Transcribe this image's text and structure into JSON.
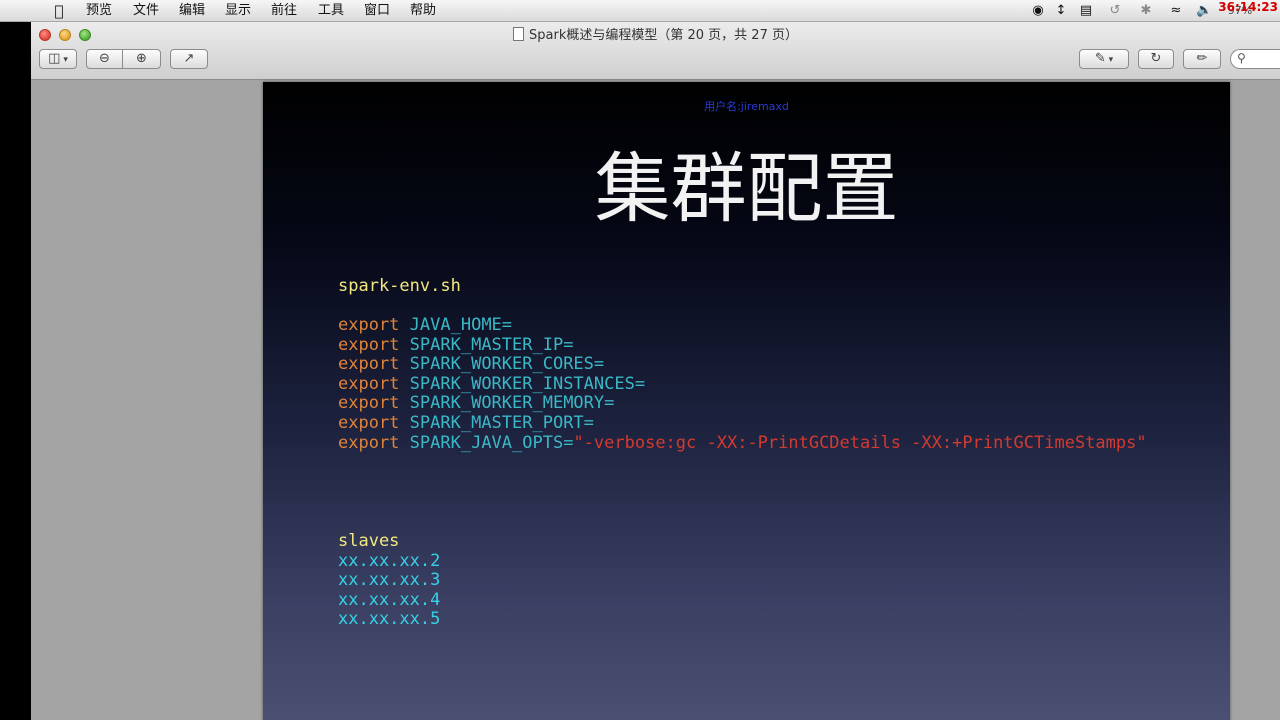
{
  "menubar": {
    "items": [
      "预览",
      "文件",
      "编辑",
      "显示",
      "前往",
      "工具",
      "窗口",
      "帮助"
    ],
    "clock": "36:14:23",
    "battery": "97%"
  },
  "window": {
    "title": "Spark概述与编程模型（第 20 页，共 27 页）"
  },
  "toolbar": {
    "sidebar_icon": "sidebar-icon",
    "zoom_out_icon": "zoom-out-icon",
    "zoom_in_icon": "zoom-in-icon",
    "share_icon": "share-icon",
    "annotate_icon": "pen-icon",
    "rotate_icon": "rotate-icon",
    "edit_icon": "edit-icon",
    "search_icon": "search-icon"
  },
  "slide": {
    "watermark": "用户名:jiremaxd",
    "title": "集群配置",
    "env_file": "spark-env.sh",
    "exports": [
      {
        "keyword": "export",
        "name": "JAVA_HOME=",
        "value": ""
      },
      {
        "keyword": "export",
        "name": "SPARK_MASTER_IP=",
        "value": ""
      },
      {
        "keyword": "export",
        "name": "SPARK_WORKER_CORES=",
        "value": ""
      },
      {
        "keyword": "export",
        "name": "SPARK_WORKER_INSTANCES=",
        "value": ""
      },
      {
        "keyword": "export",
        "name": "SPARK_WORKER_MEMORY=",
        "value": ""
      },
      {
        "keyword": "export",
        "name": "SPARK_MASTER_PORT=",
        "value": ""
      },
      {
        "keyword": "export",
        "name": "SPARK_JAVA_OPTS=",
        "value": "\"-verbose:gc -XX:-PrintGCDetails -XX:+PrintGCTimeStamps\""
      }
    ],
    "slaves_file": "slaves",
    "slaves": [
      "xx.xx.xx.2",
      "xx.xx.xx.3",
      "xx.xx.xx.4",
      "xx.xx.xx.5"
    ]
  }
}
